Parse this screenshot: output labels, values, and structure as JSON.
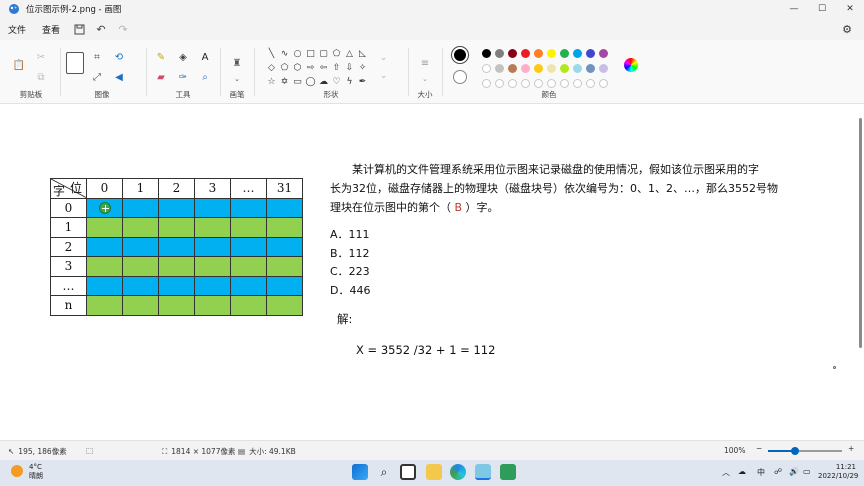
{
  "window": {
    "title": "位示图示例-2.png - 画图",
    "minimize": "—",
    "maximize": "☐",
    "close": "✕"
  },
  "menu": {
    "file": "文件",
    "view": "查看"
  },
  "ribbon": {
    "groups": {
      "clipboard": "剪贴板",
      "image": "图像",
      "tools": "工具",
      "brushes": "画笔",
      "shapes": "形状",
      "size": "大小",
      "colors": "颜色"
    },
    "palette_row1": [
      "#000000",
      "#7f7f7f",
      "#880015",
      "#ed1c24",
      "#ff7f27",
      "#fff200",
      "#22b14c",
      "#00a2e8",
      "#3f48cc",
      "#a349a4"
    ],
    "palette_row2": [
      "#ffffff",
      "#c3c3c3",
      "#b97a57",
      "#ffaec9",
      "#ffc90e",
      "#efe4b0",
      "#b5e61d",
      "#99d9ea",
      "#7092be",
      "#c8bfe7"
    ]
  },
  "bitmap_table": {
    "corner_top": "位",
    "corner_bottom": "字",
    "col_headers": [
      "0",
      "1",
      "2",
      "3",
      "…",
      "31"
    ],
    "row_headers": [
      "0",
      "1",
      "2",
      "3",
      "…",
      "n"
    ],
    "row_colors": [
      "#00b0f0",
      "#92d050",
      "#00b0f0",
      "#92d050",
      "#00b0f0",
      "#92d050"
    ]
  },
  "question": {
    "line1": "某计算机的文件管理系统采用位示图来记录磁盘的使用情况，假如该位示图采用的字",
    "line2": "长为32位，磁盘存储器上的物理块（磁盘块号）依次编号为：0、1、2、…，那么3552号物",
    "line3_a": "理块在位示图中的第个（",
    "line3_answer": " B ",
    "line3_b": "）字。",
    "options": [
      "A．111",
      "B．112",
      "C．223",
      "D．446"
    ],
    "solution_label": "解:",
    "formula": "X = 3552 /32 + 1 = 112"
  },
  "statusbar": {
    "cursor_pos": "195, 186像素",
    "image_size": "1814 × 1077像素",
    "file_size": "大小: 49.1KB",
    "zoom": "100%",
    "zoom_fraction": 0.36
  },
  "taskbar": {
    "temperature": "4°C",
    "weather": "晴朗",
    "ime": "中",
    "time": "11:21",
    "date": "2022/10/29"
  }
}
